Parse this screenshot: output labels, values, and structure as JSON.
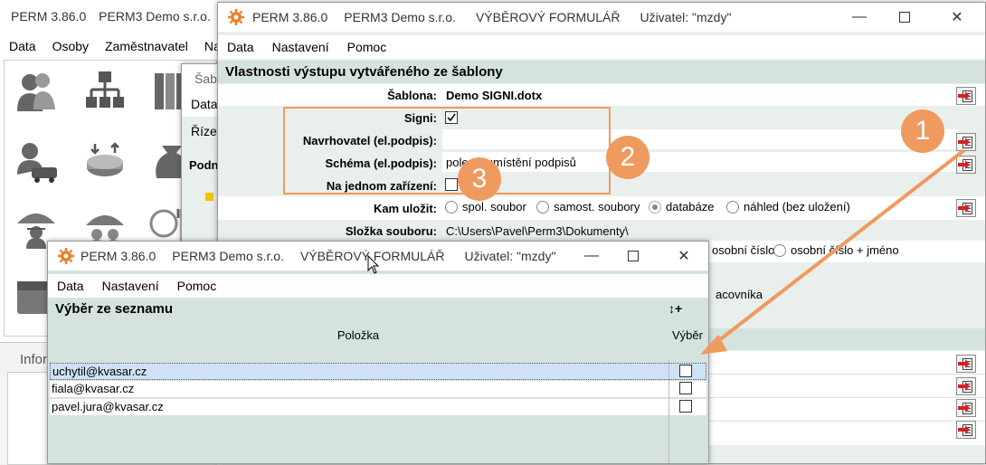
{
  "bg_window": {
    "title": "PERM 3.86.0",
    "company": "PERM3 Demo s.r.o.",
    "menu": [
      "Data",
      "Osoby",
      "Zaměstnavatel",
      "Na"
    ],
    "info_label": "Infor"
  },
  "mid_window": {
    "title_partial": "Šablo",
    "menu_partial": "Data",
    "heading_partial": "Řízen",
    "label_partial": "Podn"
  },
  "form_window": {
    "app": "PERM 3.86.0",
    "company": "PERM3 Demo s.r.o.",
    "form_name": "VÝBĚROVÝ FORMULÁŘ",
    "user": "Uživatel: \"mzdy\"",
    "menu": {
      "data": "Data",
      "settings": "Nastavení",
      "help": "Pomoc"
    },
    "section_title": "Vlastnosti výstupu vytvářeného ze šablony",
    "template_label": "Šablona:",
    "template_value": "Demo SIGNI.dotx",
    "signi_label": "Signi:",
    "signi_checked": true,
    "proposer_label": "Navrhovatel (el.podpis):",
    "proposer_value": "",
    "schema_label": "Schéma (el.podpis):",
    "schema_value": "pole … umístění podpisů",
    "one_device_label": "Na jednom zařízení:",
    "one_device_checked": false,
    "save_label": "Kam uložit:",
    "save_options": [
      "spol. soubor",
      "samost. soubory",
      "databáze",
      "náhled (bez uložení)"
    ],
    "save_selected": "databáze",
    "folder_label": "Složka souboru:",
    "folder_value": "C:\\Users\\Pavel\\Perm3\\Dokumenty\\",
    "naming_partial_1": "osobní číslo",
    "naming_partial_2": "osobní číslo + jméno",
    "employee_partial": "acovníka"
  },
  "select_window": {
    "app": "PERM 3.86.0",
    "company": "PERM3 Demo s.r.o.",
    "form_name": "VÝBĚROVÝ FORMULÁŘ",
    "user": "Uživatel: \"mzdy\"",
    "menu": {
      "data": "Data",
      "settings": "Nastavení",
      "help": "Pomoc"
    },
    "section_title": "Výběr ze seznamu",
    "sort_icon_text": "↕+",
    "columns": {
      "item": "Položka",
      "select": "Výběr"
    },
    "rows": [
      {
        "item": "uchytil@kvasar.cz",
        "selected": false
      },
      {
        "item": "fiala@kvasar.cz",
        "selected": false
      },
      {
        "item": "pavel.jura@kvasar.cz",
        "selected": false
      }
    ]
  },
  "callouts": [
    "1",
    "2",
    "3"
  ],
  "colors": {
    "accent": "#ef9a5e",
    "section_bg": "#d5e3de",
    "panel_bg": "#e8efec"
  }
}
